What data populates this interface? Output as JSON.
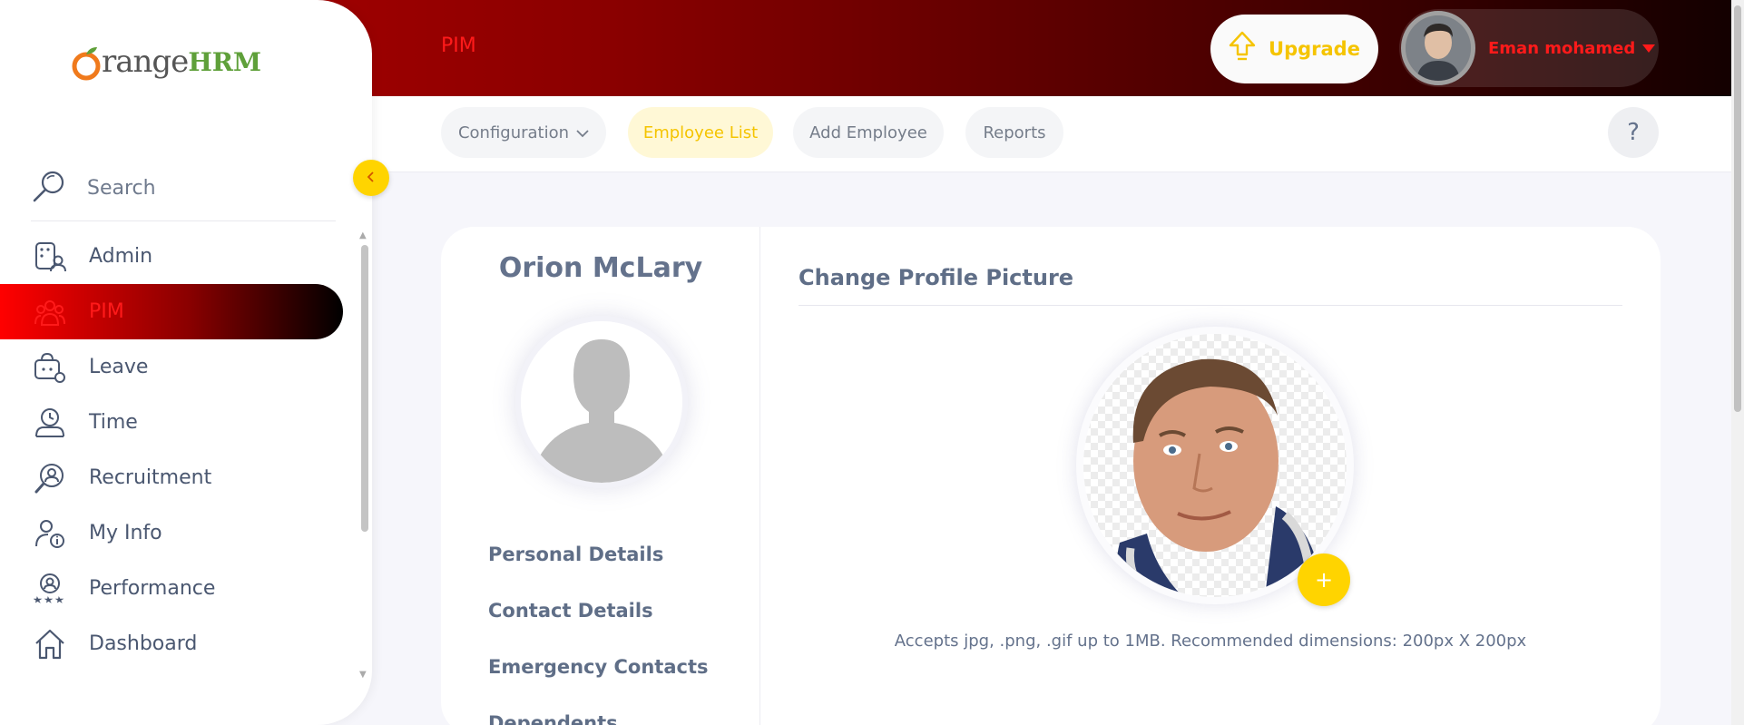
{
  "header": {
    "module_title": "PIM",
    "upgrade_label": "Upgrade",
    "user_name": "Eman mohamed"
  },
  "subnav": {
    "tabs": [
      {
        "label": "Configuration",
        "active": false
      },
      {
        "label": "Employee List",
        "active": true
      },
      {
        "label": "Add Employee",
        "active": false
      },
      {
        "label": "Reports",
        "active": false
      }
    ],
    "help_label": "?"
  },
  "sidebar": {
    "logo_word": "range",
    "logo_hrm": "HRM",
    "search_label": "Search",
    "items": [
      {
        "label": "Admin",
        "icon": "admin-icon"
      },
      {
        "label": "PIM",
        "icon": "pim-icon",
        "active": true
      },
      {
        "label": "Leave",
        "icon": "leave-icon"
      },
      {
        "label": "Time",
        "icon": "time-icon"
      },
      {
        "label": "Recruitment",
        "icon": "recruitment-icon"
      },
      {
        "label": "My Info",
        "icon": "my-info-icon"
      },
      {
        "label": "Performance",
        "icon": "performance-icon"
      },
      {
        "label": "Dashboard",
        "icon": "dashboard-icon"
      }
    ]
  },
  "employee": {
    "name": "Orion McLary",
    "links": [
      "Personal Details",
      "Contact Details",
      "Emergency Contacts",
      "Dependents"
    ]
  },
  "profile": {
    "section_title": "Change Profile Picture",
    "hint": "Accepts jpg, .png, .gif up to 1MB. Recommended dimensions: 200px X 200px",
    "add_label": "+"
  },
  "colors": {
    "accent": "#ffd400",
    "brand_red": "#ff1a1a",
    "text": "#64728c"
  }
}
